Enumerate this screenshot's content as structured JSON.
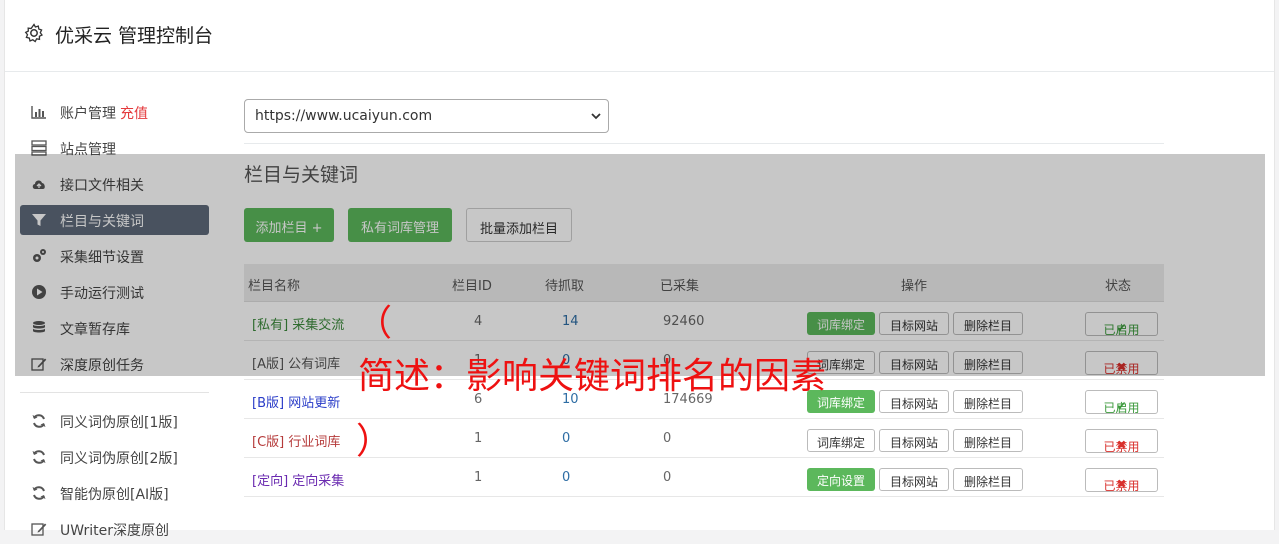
{
  "header": {
    "title": "优采云 管理控制台",
    "icon": "gear-icon"
  },
  "sidebar": {
    "items": [
      {
        "label": "账户管理",
        "extra": "充值",
        "icon": "bar-chart-icon"
      },
      {
        "label": "站点管理",
        "icon": "server-icon"
      },
      {
        "label": "接口文件相关",
        "icon": "cloud-upload-icon"
      },
      {
        "label": "栏目与关键词",
        "icon": "filter-icon"
      },
      {
        "label": "采集细节设置",
        "icon": "gears-icon"
      },
      {
        "label": "手动运行测试",
        "icon": "play-circle-icon"
      },
      {
        "label": "文章暂存库",
        "icon": "database-icon"
      },
      {
        "label": "深度原创任务",
        "icon": "edit-icon"
      },
      {
        "label": "同义词伪原创[1版]",
        "icon": "refresh-icon"
      },
      {
        "label": "同义词伪原创[2版]",
        "icon": "refresh-icon"
      },
      {
        "label": "智能伪原创[AI版]",
        "icon": "refresh-icon"
      },
      {
        "label": "UWriter深度原创",
        "icon": "edit-icon"
      }
    ],
    "active_index": 3
  },
  "site_select": {
    "value": "https://www.ucaiyun.com"
  },
  "main": {
    "title": "栏目与关键词",
    "buttons": {
      "add": "添加栏目 +",
      "private_lib": "私有词库管理",
      "batch_add": "批量添加栏目"
    }
  },
  "table": {
    "headers": {
      "name": "栏目名称",
      "id": "栏目ID",
      "pending": "待抓取",
      "collected": "已采集",
      "ops": "操作",
      "status": "状态"
    },
    "rows": [
      {
        "tag": "[私有] 采集交流",
        "id": "4",
        "pending": "14",
        "collected": "92460",
        "op1": "词库绑定",
        "op2": "目标网站",
        "op3": "删除栏目",
        "status": "已启用"
      },
      {
        "tag": "[A版] 公有词库",
        "id": "1",
        "pending": "0",
        "collected": "0",
        "op1": "词库绑定",
        "op2": "目标网站",
        "op3": "删除栏目",
        "status": "已禁用"
      },
      {
        "tag": "[B版] 网站更新",
        "id": "6",
        "pending": "10",
        "collected": "174669",
        "op1": "词库绑定",
        "op2": "目标网站",
        "op3": "删除栏目",
        "status": "已启用"
      },
      {
        "tag": "[C版] 行业词库",
        "id": "1",
        "pending": "0",
        "collected": "0",
        "op1": "词库绑定",
        "op2": "目标网站",
        "op3": "删除栏目",
        "status": "已禁用"
      },
      {
        "tag": "[定向] 定向采集",
        "id": "1",
        "pending": "0",
        "collected": "0",
        "op1": "定向设置",
        "op2": "目标网站",
        "op3": "删除栏目",
        "status": "已禁用"
      }
    ],
    "tag_colors": [
      "#3c8a3c",
      "#555555",
      "#2a3cc8",
      "#b53a3a",
      "#6a2ab0"
    ]
  },
  "annotation": {
    "open": "（",
    "text": "简述：影响关键词排名的因素",
    "close": "）"
  }
}
